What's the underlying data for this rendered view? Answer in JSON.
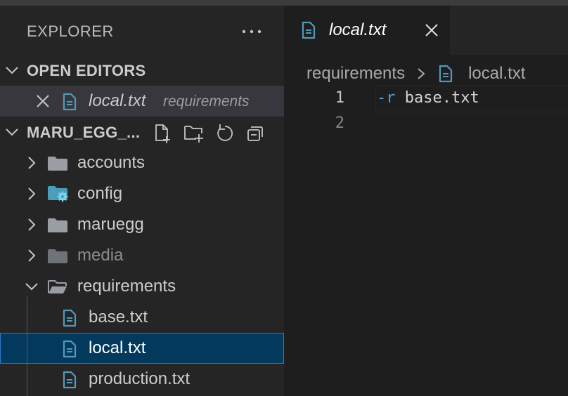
{
  "explorer": {
    "title": "EXPLORER",
    "open_editors": {
      "header": "OPEN EDITORS",
      "items": [
        {
          "name": "local.txt",
          "description": "requirements",
          "icon": "file-text-icon"
        }
      ]
    },
    "project": {
      "header": "MARU_EGG_...",
      "actions": [
        "new-file-icon",
        "new-folder-icon",
        "refresh-icon",
        "collapse-all-icon"
      ],
      "tree": [
        {
          "label": "accounts",
          "type": "folder",
          "expanded": false
        },
        {
          "label": "config",
          "type": "folder",
          "expanded": false,
          "icon": "config-folder-icon"
        },
        {
          "label": "maruegg",
          "type": "folder",
          "expanded": false
        },
        {
          "label": "media",
          "type": "folder",
          "expanded": false,
          "dimmed": true
        },
        {
          "label": "requirements",
          "type": "folder",
          "expanded": true
        },
        {
          "label": "base.txt",
          "type": "file"
        },
        {
          "label": "local.txt",
          "type": "file",
          "selected": true
        },
        {
          "label": "production.txt",
          "type": "file"
        }
      ]
    }
  },
  "editor": {
    "tab": {
      "label": "local.txt",
      "active": true
    },
    "breadcrumb": [
      "requirements",
      "local.txt"
    ],
    "lines": [
      {
        "number": "1",
        "flag": "-r",
        "text": " base.txt"
      },
      {
        "number": "2",
        "flag": "",
        "text": ""
      }
    ]
  },
  "colors": {
    "sidebar_bg": "#252526",
    "editor_bg": "#1e1e1e",
    "selection_bg": "#04395e",
    "file_icon": "#519aba",
    "keyword": "#569cd6"
  }
}
